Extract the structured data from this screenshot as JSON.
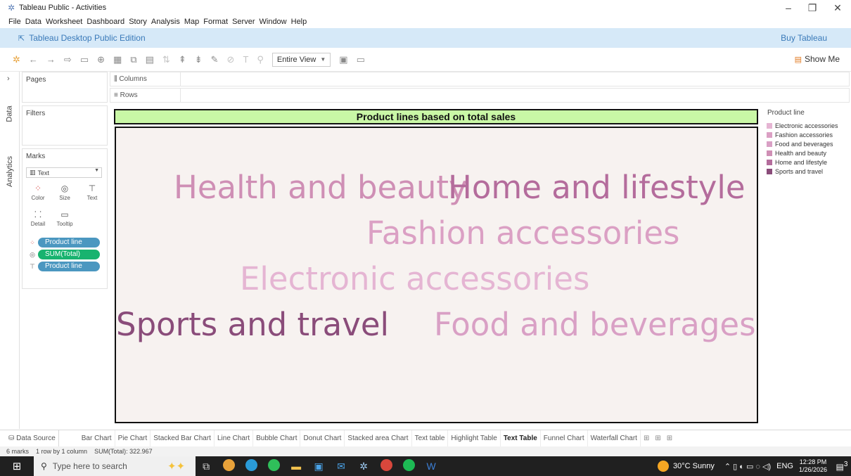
{
  "window": {
    "title": "Tableau Public - Activities",
    "minimize": "–",
    "maximize": "❐",
    "close": "✕"
  },
  "menu": [
    "File",
    "Data",
    "Worksheet",
    "Dashboard",
    "Story",
    "Analysis",
    "Map",
    "Format",
    "Server",
    "Window",
    "Help"
  ],
  "banner": {
    "edition": "Tableau Desktop Public Edition",
    "buy": "Buy Tableau"
  },
  "toolbar": {
    "view_select": "Entire View",
    "show_me": "Show Me"
  },
  "side_tabs": {
    "data": "Data",
    "analytics": "Analytics"
  },
  "pages": {
    "title": "Pages"
  },
  "filters": {
    "title": "Filters"
  },
  "marks": {
    "title": "Marks",
    "mark_type": "Text",
    "buttons": {
      "color": "Color",
      "size": "Size",
      "text": "Text",
      "detail": "Detail",
      "tooltip": "Tooltip"
    },
    "pills": [
      "Product line",
      "SUM(Total)",
      "Product line"
    ]
  },
  "shelves": {
    "columns": "Columns",
    "rows": "Rows"
  },
  "view": {
    "title": "Product lines based on total sales",
    "words": [
      {
        "label": "Health and beauty",
        "color": "#cf8fb5"
      },
      {
        "label": "Home and lifestyle",
        "color": "#b46c9c"
      },
      {
        "label": "Fashion accessories",
        "color": "#dba0c4"
      },
      {
        "label": "Electronic accessories",
        "color": "#e5b5d3"
      },
      {
        "label": "Sports and travel",
        "color": "#8a4c7a"
      },
      {
        "label": "Food and beverages",
        "color": "#d9a0c5"
      }
    ]
  },
  "legend": {
    "title": "Product line",
    "items": [
      {
        "label": "Electronic accessories",
        "color": "#e5b5d3"
      },
      {
        "label": "Fashion accessories",
        "color": "#dba0c4"
      },
      {
        "label": "Food and beverages",
        "color": "#d9a0c5"
      },
      {
        "label": "Health and beauty",
        "color": "#cf8fb5"
      },
      {
        "label": "Home and lifestyle",
        "color": "#b46c9c"
      },
      {
        "label": "Sports and travel",
        "color": "#8a4c7a"
      }
    ]
  },
  "sheet_tabs": {
    "data_source": "Data Source",
    "tabs": [
      "Bar Chart",
      "Pie Chart",
      "Stacked Bar Chart",
      "Line Chart",
      "Bubble Chart",
      "Donut Chart",
      "Stacked area Chart",
      "Text table",
      "Highlight Table",
      "Text Table",
      "Funnel Chart",
      "Waterfall Chart"
    ],
    "active": "Text Table"
  },
  "status": {
    "marks": "6 marks",
    "dims": "1 row by 1 column",
    "sum": "SUM(Total): 322.967"
  },
  "taskbar": {
    "search_placeholder": "Type here to search",
    "weather": "30°C  Sunny",
    "lang": "ENG",
    "time": "12:28 PM",
    "date": "1/26/2026",
    "notifications": "3"
  }
}
